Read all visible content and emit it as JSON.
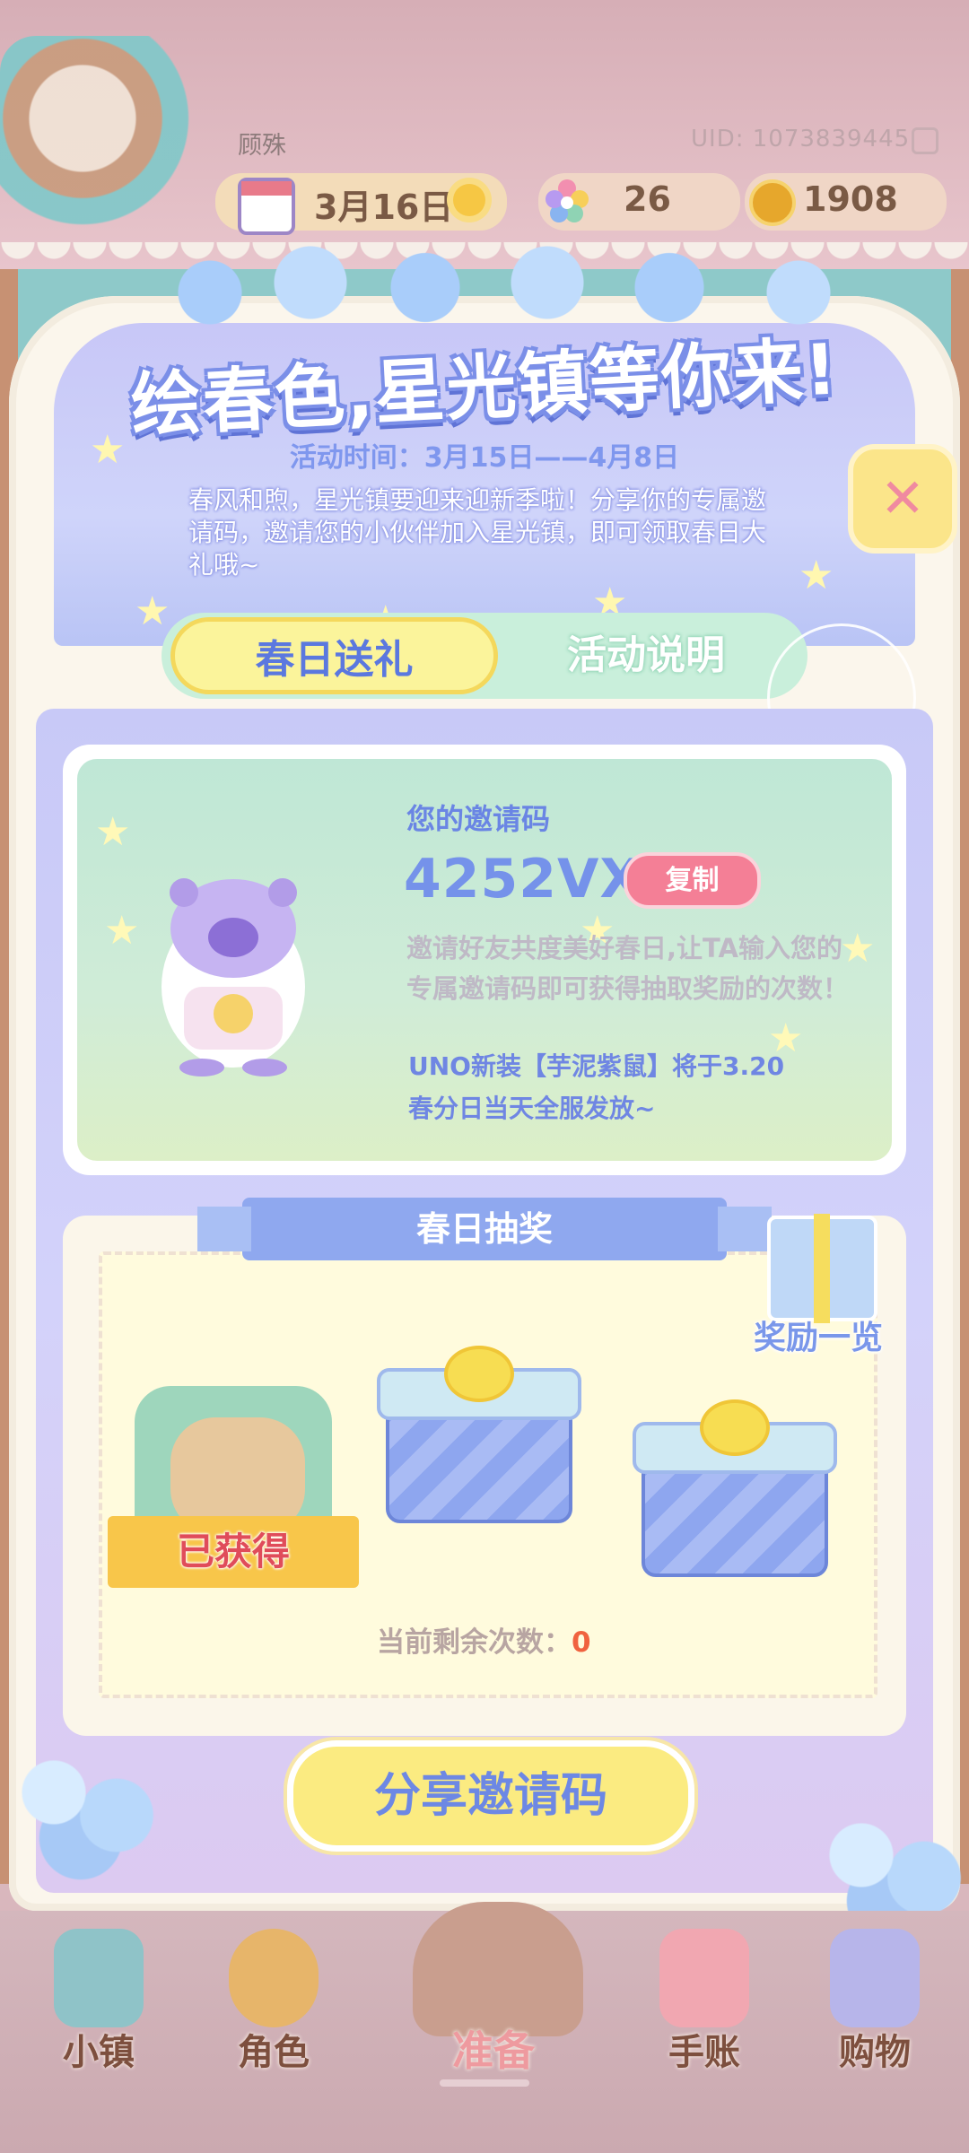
{
  "header": {
    "username": "顾殊",
    "uid": "UID: 1073839445",
    "date": "3月16日",
    "gem_count": "26",
    "coin_count": "1908"
  },
  "event": {
    "title": "绘春色,星光镇等你来!",
    "time": "活动时间：3月15日——4月8日",
    "description": "春风和煦，星光镇要迎来迎新季啦！分享你的专属邀请码，邀请您的小伙伴加入星光镇，即可领取春日大礼哦~",
    "tabs": [
      {
        "label": "春日送礼",
        "active": true
      },
      {
        "label": "活动说明",
        "active": false
      }
    ]
  },
  "invite": {
    "title": "您的邀请码",
    "code": "4252VX",
    "copy_label": "复制",
    "info": "邀请好友共度美好春日,让TA输入您的专属邀请码即可获得抽取奖励的次数！",
    "notice_line1": "UNO新装【芋泥紫鼠】将于3.20",
    "notice_line2": "春分日当天全服发放~"
  },
  "lottery": {
    "title": "春日抽奖",
    "reward_list_label": "奖励一览",
    "claimed_label": "已获得",
    "remaining_label": "当前剩余次数：",
    "remaining_count": "0"
  },
  "share_button": "分享邀请码",
  "nav": [
    {
      "label": "小镇",
      "icon": "map-icon"
    },
    {
      "label": "角色",
      "icon": "character-icon"
    },
    {
      "label": "准备",
      "icon": "picnic-basket-icon"
    },
    {
      "label": "手账",
      "icon": "journal-icon"
    },
    {
      "label": "购物",
      "icon": "shopping-bag-icon"
    }
  ],
  "colors": {
    "accent_blue": "#7592ea",
    "pink": "#f47f96",
    "yellow": "#fbeb81"
  }
}
